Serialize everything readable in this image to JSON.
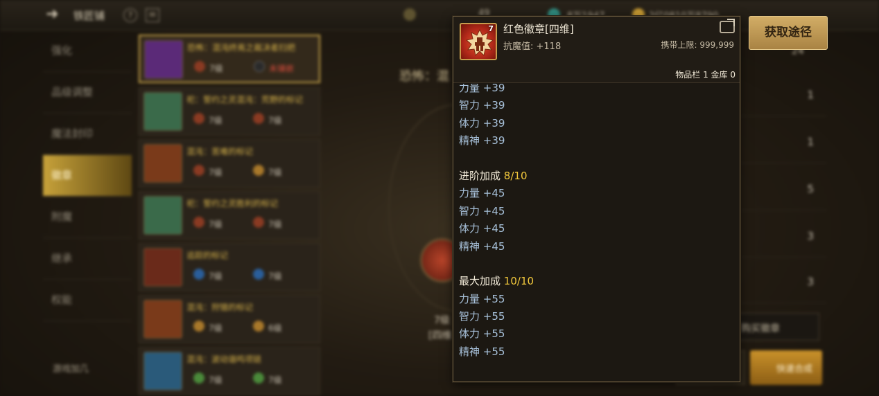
{
  "header": {
    "title": "铁匠铺",
    "currencies": [
      "49",
      "8万1947",
      "2亿0810万8790"
    ]
  },
  "sidebar": {
    "items": [
      {
        "label": "强化"
      },
      {
        "label": "品级调整"
      },
      {
        "label": "魔法封印"
      },
      {
        "label": "徽章"
      },
      {
        "label": "附魔"
      },
      {
        "label": "继承"
      },
      {
        "label": "权能"
      }
    ],
    "brand": "游戏加几"
  },
  "item_list": [
    {
      "name": "恐怖：混沌终焉之裁决者扫把",
      "lvl1": "7级",
      "lvl2": "未镶嵌"
    },
    {
      "name": "祀：誓约之灵混沌：荒野的标记",
      "lvl1": "7级",
      "lvl2": "7级"
    },
    {
      "name": "混沌：苦难的标记",
      "lvl1": "7级",
      "lvl2": "7级"
    },
    {
      "name": "祀：誓约之灵胜利的标记",
      "lvl1": "7级",
      "lvl2": "7级"
    },
    {
      "name": "追踪的标记",
      "lvl1": "7级",
      "lvl2": "7级"
    },
    {
      "name": "混沌：狩猎的标记",
      "lvl1": "7级",
      "lvl2": "6级"
    },
    {
      "name": "混沌：波动谐鸣项链",
      "lvl1": "7级",
      "lvl2": "7级"
    }
  ],
  "center": {
    "title": "恐怖：混",
    "emblem_level": "7级",
    "emblem_type": "[四维"
  },
  "right_panel": {
    "total": "24",
    "counts": [
      "1",
      "1",
      "5",
      "3",
      "3"
    ],
    "buy_label": "购买徽章",
    "quick_label": "快速合成"
  },
  "tooltip": {
    "icon_level": "7",
    "name": "红色徽章[四维]",
    "resist": "抗魔值: +118",
    "carry_limit": "携带上限: 999,999",
    "stock": "物品栏 1 金库 0",
    "base_stats": [
      "力量 +39",
      "智力 +39",
      "体力 +39",
      "精神 +39"
    ],
    "advance": {
      "title": "进阶加成",
      "fraction": "8/10",
      "stats": [
        "力量 +45",
        "智力 +45",
        "体力 +45",
        "精神 +45"
      ]
    },
    "max": {
      "title": "最大加成",
      "fraction": "10/10",
      "stats": [
        "力量 +55",
        "智力 +55",
        "体力 +55",
        "精神 +55"
      ]
    },
    "get_button": "获取途径"
  },
  "colors": {
    "stat_text": "#a7c0d9",
    "fraction": "#f3c93c",
    "get_button": "#c9a35c",
    "emblem_red": "#b3291a"
  }
}
